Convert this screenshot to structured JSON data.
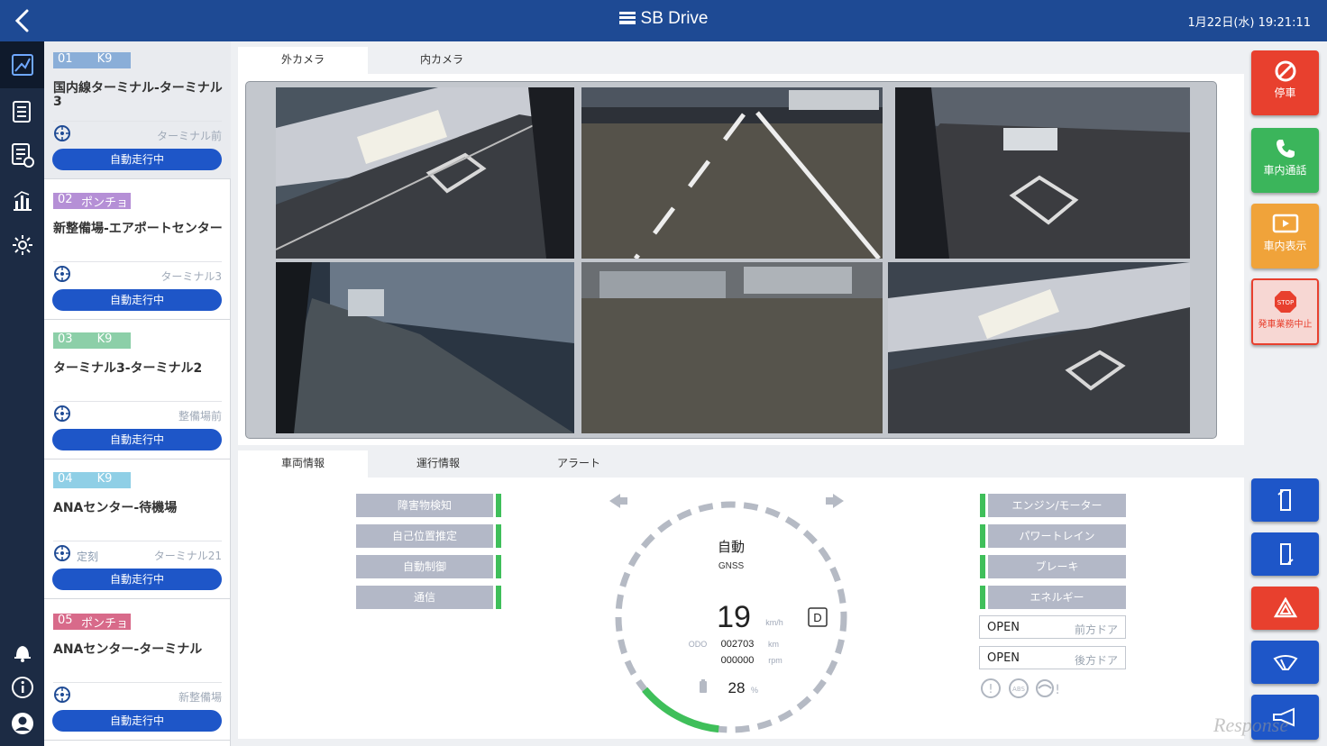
{
  "header": {
    "brand": "SB Drive",
    "datetime": "1月22日(水)  19:21:11"
  },
  "nav": {
    "icons": [
      "map-icon",
      "list-icon",
      "report-icon",
      "chart-icon",
      "settings-icon",
      "bell-icon",
      "info-icon",
      "user-icon"
    ]
  },
  "routes": [
    {
      "no": "01",
      "bus": "K9",
      "no_color": "#8aaed8",
      "bus_color": "#8aaed8",
      "title": "国内線ターミナル-ターミナル3",
      "kind": "",
      "stop": "ターミナル前",
      "status": "自動走行中"
    },
    {
      "no": "02",
      "bus": "ポンチョ",
      "no_color": "#b58fd6",
      "bus_color": "#b58fd6",
      "title": "新整備場-エアポートセンター",
      "kind": "",
      "stop": "ターミナル3",
      "status": "自動走行中"
    },
    {
      "no": "03",
      "bus": "K9",
      "no_color": "#8ccfa8",
      "bus_color": "#8ccfa8",
      "title": "ターミナル3-ターミナル2",
      "kind": "",
      "stop": "整備場前",
      "status": "自動走行中"
    },
    {
      "no": "04",
      "bus": "K9",
      "no_color": "#8fcfe6",
      "bus_color": "#8fcfe6",
      "title": "ANAセンター-待機場",
      "kind": "定刻",
      "stop": "ターミナル21",
      "status": "自動走行中"
    },
    {
      "no": "05",
      "bus": "ポンチョ",
      "no_color": "#d86a8a",
      "bus_color": "#d86a8a",
      "title": "ANAセンター-ターミナル",
      "kind": "",
      "stop": "新整備場",
      "status": "自動走行中"
    }
  ],
  "camera_tabs": [
    "外カメラ",
    "内カメラ"
  ],
  "info_tabs": [
    "車両情報",
    "運行情報",
    "アラート"
  ],
  "systems_left": [
    "障害物検知",
    "自己位置推定",
    "自動制御",
    "通信"
  ],
  "systems_right": [
    "エンジン/モーター",
    "パワートレイン",
    "ブレーキ",
    "エネルギー"
  ],
  "doors": [
    {
      "state": "OPEN",
      "name": "前方ドア"
    },
    {
      "state": "OPEN",
      "name": "後方ドア"
    }
  ],
  "gauge": {
    "mode": "自動",
    "positioning": "GNSS",
    "speed": "19",
    "speed_unit": "km/h",
    "gear": "D",
    "odo_label": "ODO",
    "odo": "002703",
    "odo_unit": "km",
    "rpm": "000000",
    "rpm_unit": "rpm",
    "battery": "28",
    "battery_unit": "%",
    "battery_level": 0.28
  },
  "actions": [
    {
      "label": "停車",
      "color": "#e8402e",
      "icon": "no-entry-icon"
    },
    {
      "label": "車内通話",
      "color": "#3bb55b",
      "icon": "phone-icon"
    },
    {
      "label": "車内表示",
      "color": "#f0a33a",
      "icon": "display-icon"
    },
    {
      "label": "発車業務中止",
      "color": "#f7d7d3",
      "icon": "stop-sign-icon",
      "stop_text": "STOP"
    }
  ],
  "controls": [
    "front-door-icon",
    "rear-door-icon",
    "hazard-icon",
    "wiper-icon",
    "horn-icon"
  ],
  "watermark": "Response"
}
